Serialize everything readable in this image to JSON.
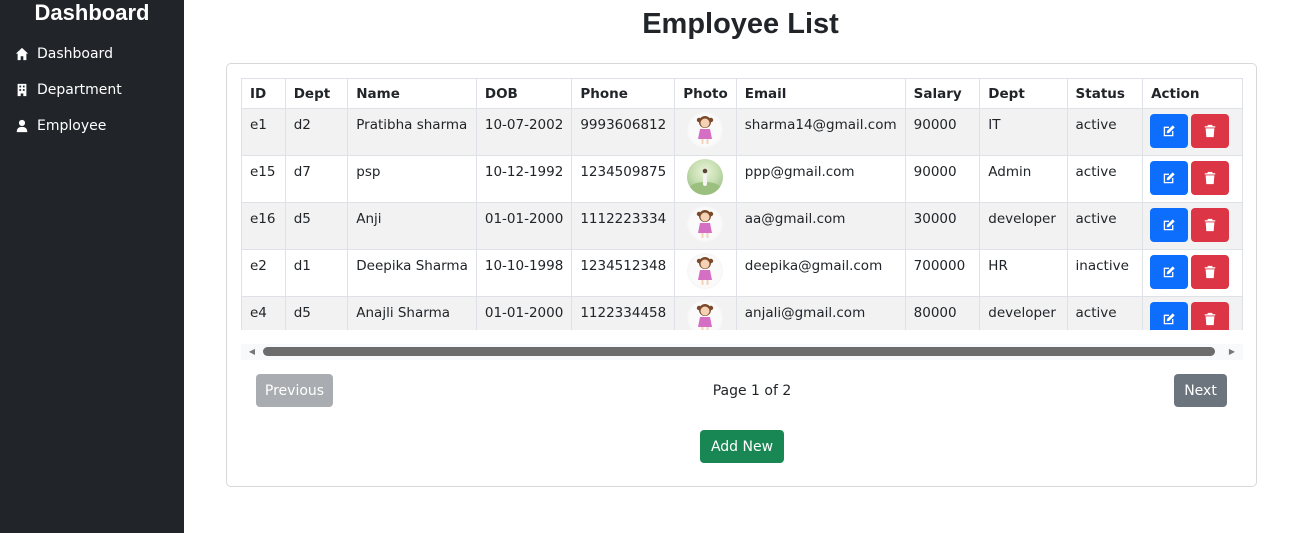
{
  "sidebar": {
    "title": "Dashboard",
    "items": [
      {
        "label": "Dashboard",
        "icon": "home-icon"
      },
      {
        "label": "Department",
        "icon": "building-icon"
      },
      {
        "label": "Employee",
        "icon": "user-tie-icon"
      }
    ]
  },
  "page": {
    "title": "Employee List"
  },
  "table": {
    "headers": [
      "ID",
      "Dept",
      "Name",
      "DOB",
      "Phone",
      "Photo",
      "Email",
      "Salary",
      "Dept",
      "Status",
      "Action"
    ],
    "rows": [
      {
        "id": "e1",
        "dept_id": "d2",
        "name": "Pratibha sharma",
        "dob": "10-07-2002",
        "phone": "9993606812",
        "photo": "girl-avatar",
        "email": "sharma14@gmail.com",
        "salary": "90000",
        "dept": "IT",
        "status": "active"
      },
      {
        "id": "e15",
        "dept_id": "d7",
        "name": "psp",
        "dob": "10-12-1992",
        "phone": "1234509875",
        "photo": "outdoor-photo",
        "email": "ppp@gmail.com",
        "salary": "90000",
        "dept": "Admin",
        "status": "active"
      },
      {
        "id": "e16",
        "dept_id": "d5",
        "name": "Anji",
        "dob": "01-01-2000",
        "phone": "1112223334",
        "photo": "girl-avatar",
        "email": "aa@gmail.com",
        "salary": "30000",
        "dept": "developer",
        "status": "active"
      },
      {
        "id": "e2",
        "dept_id": "d1",
        "name": "Deepika Sharma",
        "dob": "10-10-1998",
        "phone": "1234512348",
        "photo": "girl-avatar",
        "email": "deepika@gmail.com",
        "salary": "700000",
        "dept": "HR",
        "status": "inactive"
      },
      {
        "id": "e4",
        "dept_id": "d5",
        "name": "Anajli Sharma",
        "dob": "01-01-2000",
        "phone": "1122334458",
        "photo": "girl-avatar",
        "email": "anjali@gmail.com",
        "salary": "80000",
        "dept": "developer",
        "status": "active"
      }
    ]
  },
  "pagination": {
    "previous_label": "Previous",
    "next_label": "Next",
    "page_info": "Page 1 of 2"
  },
  "actions": {
    "add_new_label": "Add New"
  },
  "colors": {
    "sidebar_bg": "#212529",
    "edit": "#0d6efd",
    "delete": "#dc3545",
    "add": "#198754",
    "next": "#6c757d",
    "previous_disabled": "#a9acb0"
  }
}
